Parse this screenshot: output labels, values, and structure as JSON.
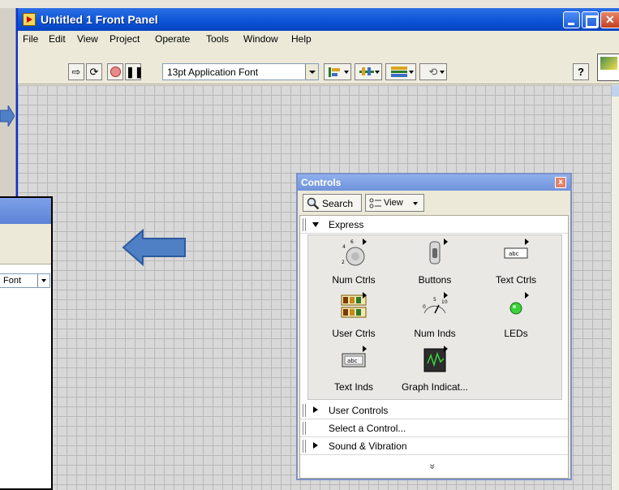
{
  "window": {
    "title": "Untitled 1 Front Panel",
    "buttons": {
      "minimize": "minimize-icon",
      "maximize": "maximize-icon",
      "close": "close-icon"
    }
  },
  "menu": [
    "File",
    "Edit",
    "View",
    "Project",
    "Operate",
    "Tools",
    "Window",
    "Help"
  ],
  "toolbar": {
    "font_select_value": "13pt Application Font",
    "help_label": "?",
    "icons": [
      "run-icon",
      "run-continuously-icon",
      "abort-icon",
      "pause-icon",
      "align-objects-icon",
      "distribute-objects-icon",
      "resize-objects-icon",
      "reorder-icon"
    ]
  },
  "second_window": {
    "font_select_value": "Font"
  },
  "palette": {
    "title": "Controls",
    "close_label": "x",
    "search_label": "Search",
    "view_label": "View",
    "categories": {
      "express": "Express",
      "user_controls": "User Controls",
      "select_control": "Select a Control...",
      "sound_vibration": "Sound & Vibration"
    },
    "items": [
      {
        "label": "Num Ctrls",
        "icon": "knob-icon"
      },
      {
        "label": "Buttons",
        "icon": "toggle-switch-icon"
      },
      {
        "label": "Text Ctrls",
        "icon": "text-control-icon"
      },
      {
        "label": "User Ctrls",
        "icon": "user-controls-icon"
      },
      {
        "label": "Num Inds",
        "icon": "meter-icon"
      },
      {
        "label": "LEDs",
        "icon": "led-icon"
      },
      {
        "label": "Text Inds",
        "icon": "text-indicator-icon"
      },
      {
        "label": "Graph Indicat...",
        "icon": "graph-icon"
      }
    ],
    "more_label": "»"
  },
  "colors": {
    "title_blue": "#0a53d6",
    "arrow_blue": "#4f7fc4",
    "panel_grid": "#d8d8d8"
  }
}
